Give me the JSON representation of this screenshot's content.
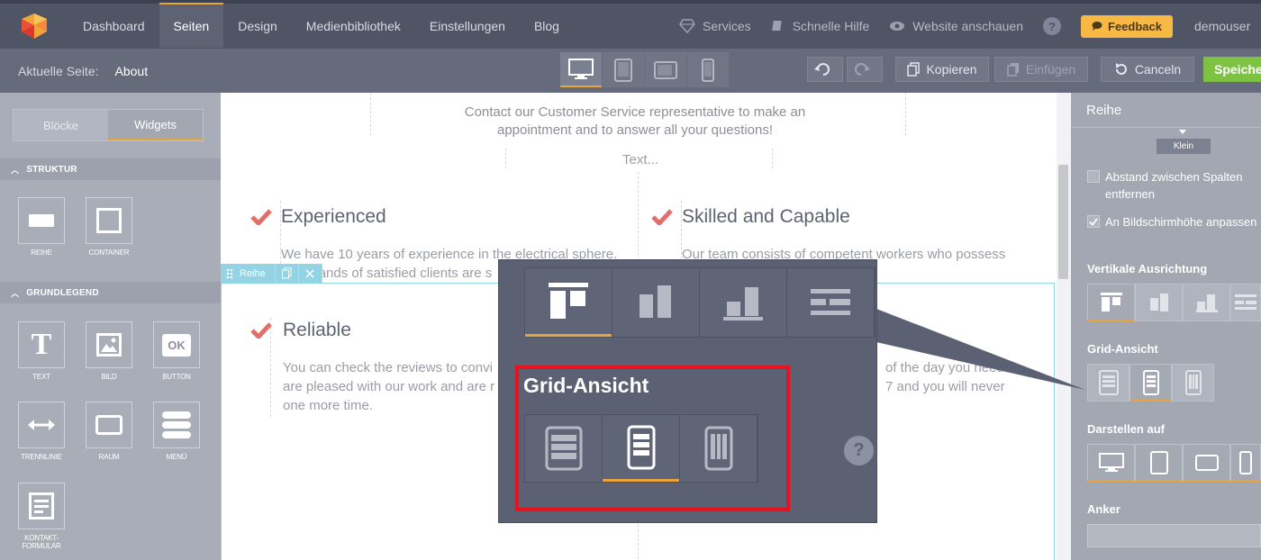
{
  "nav": {
    "items": [
      "Dashboard",
      "Seiten",
      "Design",
      "Medienbibliothek",
      "Einstellungen",
      "Blog"
    ],
    "active_index": 1,
    "right": {
      "services": "Services",
      "help": "Schnelle Hilfe",
      "preview": "Website anschauen",
      "help_icon": "?",
      "feedback": "Feedback",
      "user": "demouser"
    }
  },
  "subbar": {
    "current_label": "Aktuelle Seite:",
    "current_value": "About",
    "devices": [
      "desktop-icon",
      "tablet-portrait-icon",
      "tablet-landscape-icon",
      "phone-icon"
    ],
    "copy": "Kopieren",
    "paste": "Einfügen",
    "cancel": "Canceln",
    "save": "Speichern"
  },
  "leftbar": {
    "tabs": [
      "Blöcke",
      "Widgets"
    ],
    "active_tab": 1,
    "sections": {
      "structure": "STRUKTUR",
      "basic": "GRUNDLEGEND"
    },
    "structure_widgets": [
      "REIHE",
      "CONTAINER"
    ],
    "basic_widgets": [
      "TEXT",
      "BILD",
      "BUTTON",
      "TRENNLINIE",
      "RAUM",
      "MENÜ",
      "KONTAKT-FORMULAR"
    ],
    "button_icon_text": "OK",
    "text_icon_text": "T"
  },
  "canvas": {
    "intro": "Contact our Customer Service representative to make an appointment and to answer all your questions!",
    "placeholder": "Text...",
    "features": [
      {
        "title": "Experienced",
        "text": "We have 10 years of experience in the electrical sphere. Thousands of satisfied clients are s"
      },
      {
        "title": "Skilled and Capable",
        "text": "Our team consists of competent workers who possess seasoned professionals."
      },
      {
        "title": "Reliable",
        "text": "You can check the reviews to convi are pleased with our work and are r one more time."
      },
      {
        "title": "",
        "text": "of the day you need 7 and you will never"
      }
    ],
    "row_toolbar_label": "Reihe"
  },
  "rightpanel": {
    "title": "Reihe",
    "size_badge": "Klein",
    "checkbox_remove_gap": "Abstand zwischen Spalten entfernen",
    "checkbox_fit_height": "An Bildschirmhöhe anpassen",
    "vertical_align_label": "Vertikale Ausrichtung",
    "grid_view_label": "Grid-Ansicht",
    "show_on_label": "Darstellen auf",
    "anchor_label": "Anker"
  },
  "zoom": {
    "grid_title": "Grid-Ansicht",
    "help": "?"
  },
  "colors": {
    "accent": "#e8a33a",
    "save": "#7dc242",
    "feedback": "#f7b944",
    "highlight": "#e8111c",
    "check": "#e36f6a"
  }
}
